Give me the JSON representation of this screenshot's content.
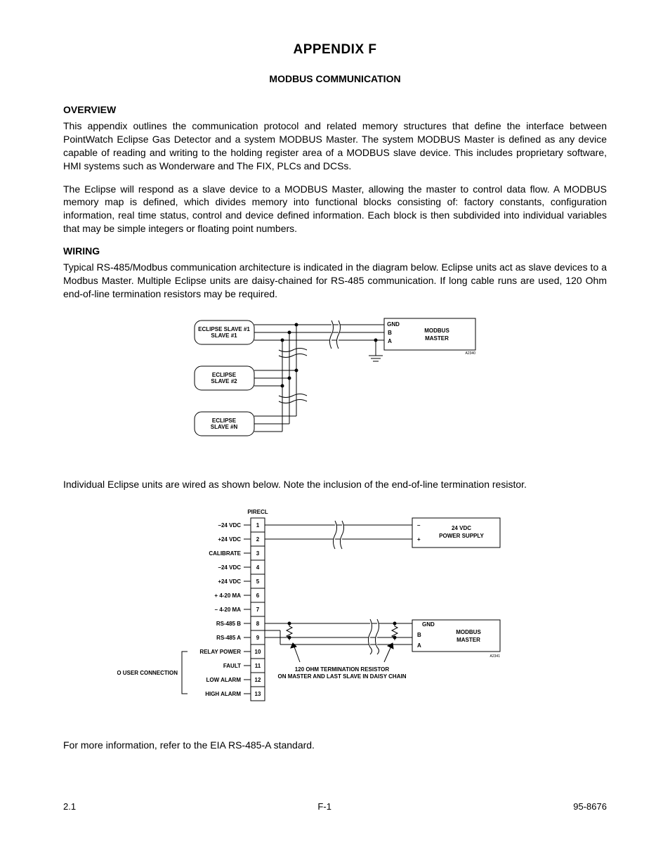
{
  "title": "APPENDIX F",
  "subtitle": "MODBUS COMMUNICATION",
  "sections": {
    "overview": {
      "heading": "OVERVIEW",
      "p1": "This appendix outlines the communication protocol and related memory structures that define the interface between PointWatch Eclipse Gas Detector and a system MODBUS Master.  The system MODBUS Master is defined as any device capable of reading and writing to the holding register area of a MODBUS slave device.  This includes proprietary software, HMI systems such as Wonderware and The FIX, PLCs and DCSs.",
      "p2": "The Eclipse will respond as a slave device to a MODBUS Master, allowing the master to control data flow.  A MODBUS memory map is defined, which divides memory into functional blocks consisting of: factory constants,  configuration information, real time status, control and device defined information.  Each block is then subdivided into individual variables that may be simple integers or floating point numbers."
    },
    "wiring": {
      "heading": "WIRING",
      "p1": "Typical RS-485/Modbus communication architecture is indicated in the diagram below.  Eclipse units act as slave devices to a Modbus Master.  Multiple Eclipse units are daisy-chained for RS-485 communication.  If long cable runs are used, 120 Ohm end-of-line termination resistors may be required.",
      "p2": "Individual Eclipse units are wired as shown below.  Note the inclusion of the end-of-line termination resistor.",
      "p3": "For more information, refer to the EIA RS-485-A standard."
    }
  },
  "diagram1": {
    "slave1": "ECLIPSE\nSLAVE #1",
    "slave2": "ECLIPSE\nSLAVE #2",
    "slaveN": "ECLIPSE\nSLAVE #N",
    "gnd": "GND",
    "b": "B",
    "a": "A",
    "master": "MODBUS\nMASTER",
    "code": "A2340"
  },
  "diagram2": {
    "header": "PIRECL",
    "pins": {
      "1": "–24 VDC",
      "2": "+24 VDC",
      "3": "CALIBRATE",
      "4": "–24 VDC",
      "5": "+24 VDC",
      "6": "+ 4-20 MA",
      "7": "– 4-20 MA",
      "8": "RS-485 B",
      "9": "RS-485 A",
      "10": "RELAY POWER",
      "11": "FAULT",
      "12": "LOW ALARM",
      "13": "HIGH ALARM"
    },
    "noUser": "NO USER CONNECTION",
    "psMinus": "–",
    "psPlus": "+",
    "psLabel": "24 VDC\nPOWER SUPPLY",
    "gnd": "GND",
    "b": "B",
    "a": "A",
    "master": "MODBUS\nMASTER",
    "resistorNote": "120 OHM TERMINATION RESISTOR\nON MASTER AND LAST SLAVE IN DAISY CHAIN",
    "code": "A2341"
  },
  "footer": {
    "left": "2.1",
    "center": "F-1",
    "right": "95-8676"
  }
}
